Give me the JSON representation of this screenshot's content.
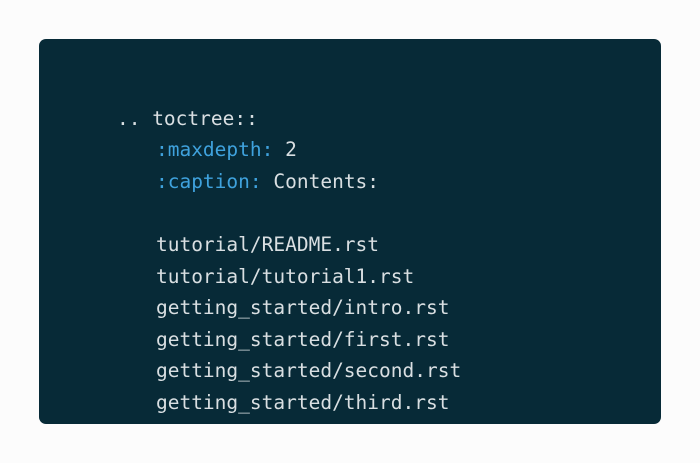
{
  "colors": {
    "page_background": "#fcfcfc",
    "code_background": "#072a37",
    "code_text": "#d9dfe2",
    "field_key": "#3fa2dd"
  },
  "code": {
    "directive": ".. toctree::",
    "options": [
      {
        "key": ":maxdepth:",
        "value": " 2"
      },
      {
        "key": ":caption:",
        "value": " Contents:"
      }
    ],
    "entries": [
      "tutorial/README.rst",
      "tutorial/tutorial1.rst",
      "getting_started/intro.rst",
      "getting_started/first.rst",
      "getting_started/second.rst",
      "getting_started/third.rst"
    ]
  }
}
